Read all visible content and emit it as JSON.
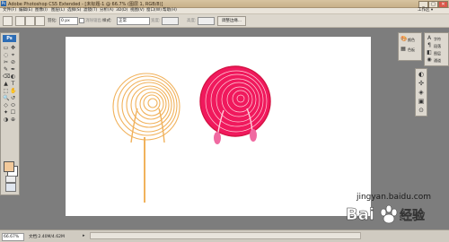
{
  "window": {
    "title": "Adobe Photoshop CS5 Extended - [未标题-1 @ 66.7% (图层 1, RGB/8)]",
    "minimize": "_",
    "maximize": "□",
    "close": "✕"
  },
  "menu": {
    "items": [
      "文件(F)",
      "编辑(E)",
      "图像(I)",
      "图层(L)",
      "选择(S)",
      "滤镜(T)",
      "分析(A)",
      "3D(D)",
      "视图(V)",
      "窗口(W)",
      "帮助(H)"
    ],
    "workspace": "工作区 ▾"
  },
  "options": {
    "feather_label": "羽化:",
    "feather_value": "0 px",
    "antialias_label": "消除锯齿",
    "style_label": "样式:",
    "style_value": "正常",
    "width_label": "宽度:",
    "height_label": "高度:",
    "refine_label": "调整边缘..."
  },
  "toolbox": {
    "logo": "Ps",
    "tools": [
      "▭",
      "✥",
      "◌",
      "⌖",
      "✂",
      "⊘",
      "✎",
      "✒",
      "⌫",
      "◐",
      "▲",
      "T",
      "⬚",
      "✋",
      "🔍",
      "↺",
      "◇",
      "⬭",
      "✦",
      "☐",
      "◑",
      "⊕"
    ],
    "foreground_color": "#f2c99a",
    "background_color": "#ffffff"
  },
  "panels": {
    "group_a": [
      {
        "icon": "🎨",
        "label": "颜色"
      },
      {
        "icon": "▦",
        "label": "色板"
      }
    ],
    "group_b": [
      {
        "icon": "A",
        "label": "字符"
      },
      {
        "icon": "¶",
        "label": "段落"
      },
      {
        "icon": "◧",
        "label": "图层"
      },
      {
        "icon": "◉",
        "label": "通道"
      }
    ],
    "group_c": [
      "◐",
      "✣",
      "◈",
      "▣",
      "⊙"
    ]
  },
  "status": {
    "zoom": "66.67%",
    "doc": "文档:2.40M/4.62M",
    "arrow": "▸"
  },
  "watermark": {
    "url": "jingyan.baidu.com",
    "logo": "Baidu 经验"
  },
  "artwork": {
    "left_lollipop_color": "#f1b25c",
    "right_lollipop_fill": "#f0195d",
    "right_lollipop_stroke": "#d31242"
  }
}
